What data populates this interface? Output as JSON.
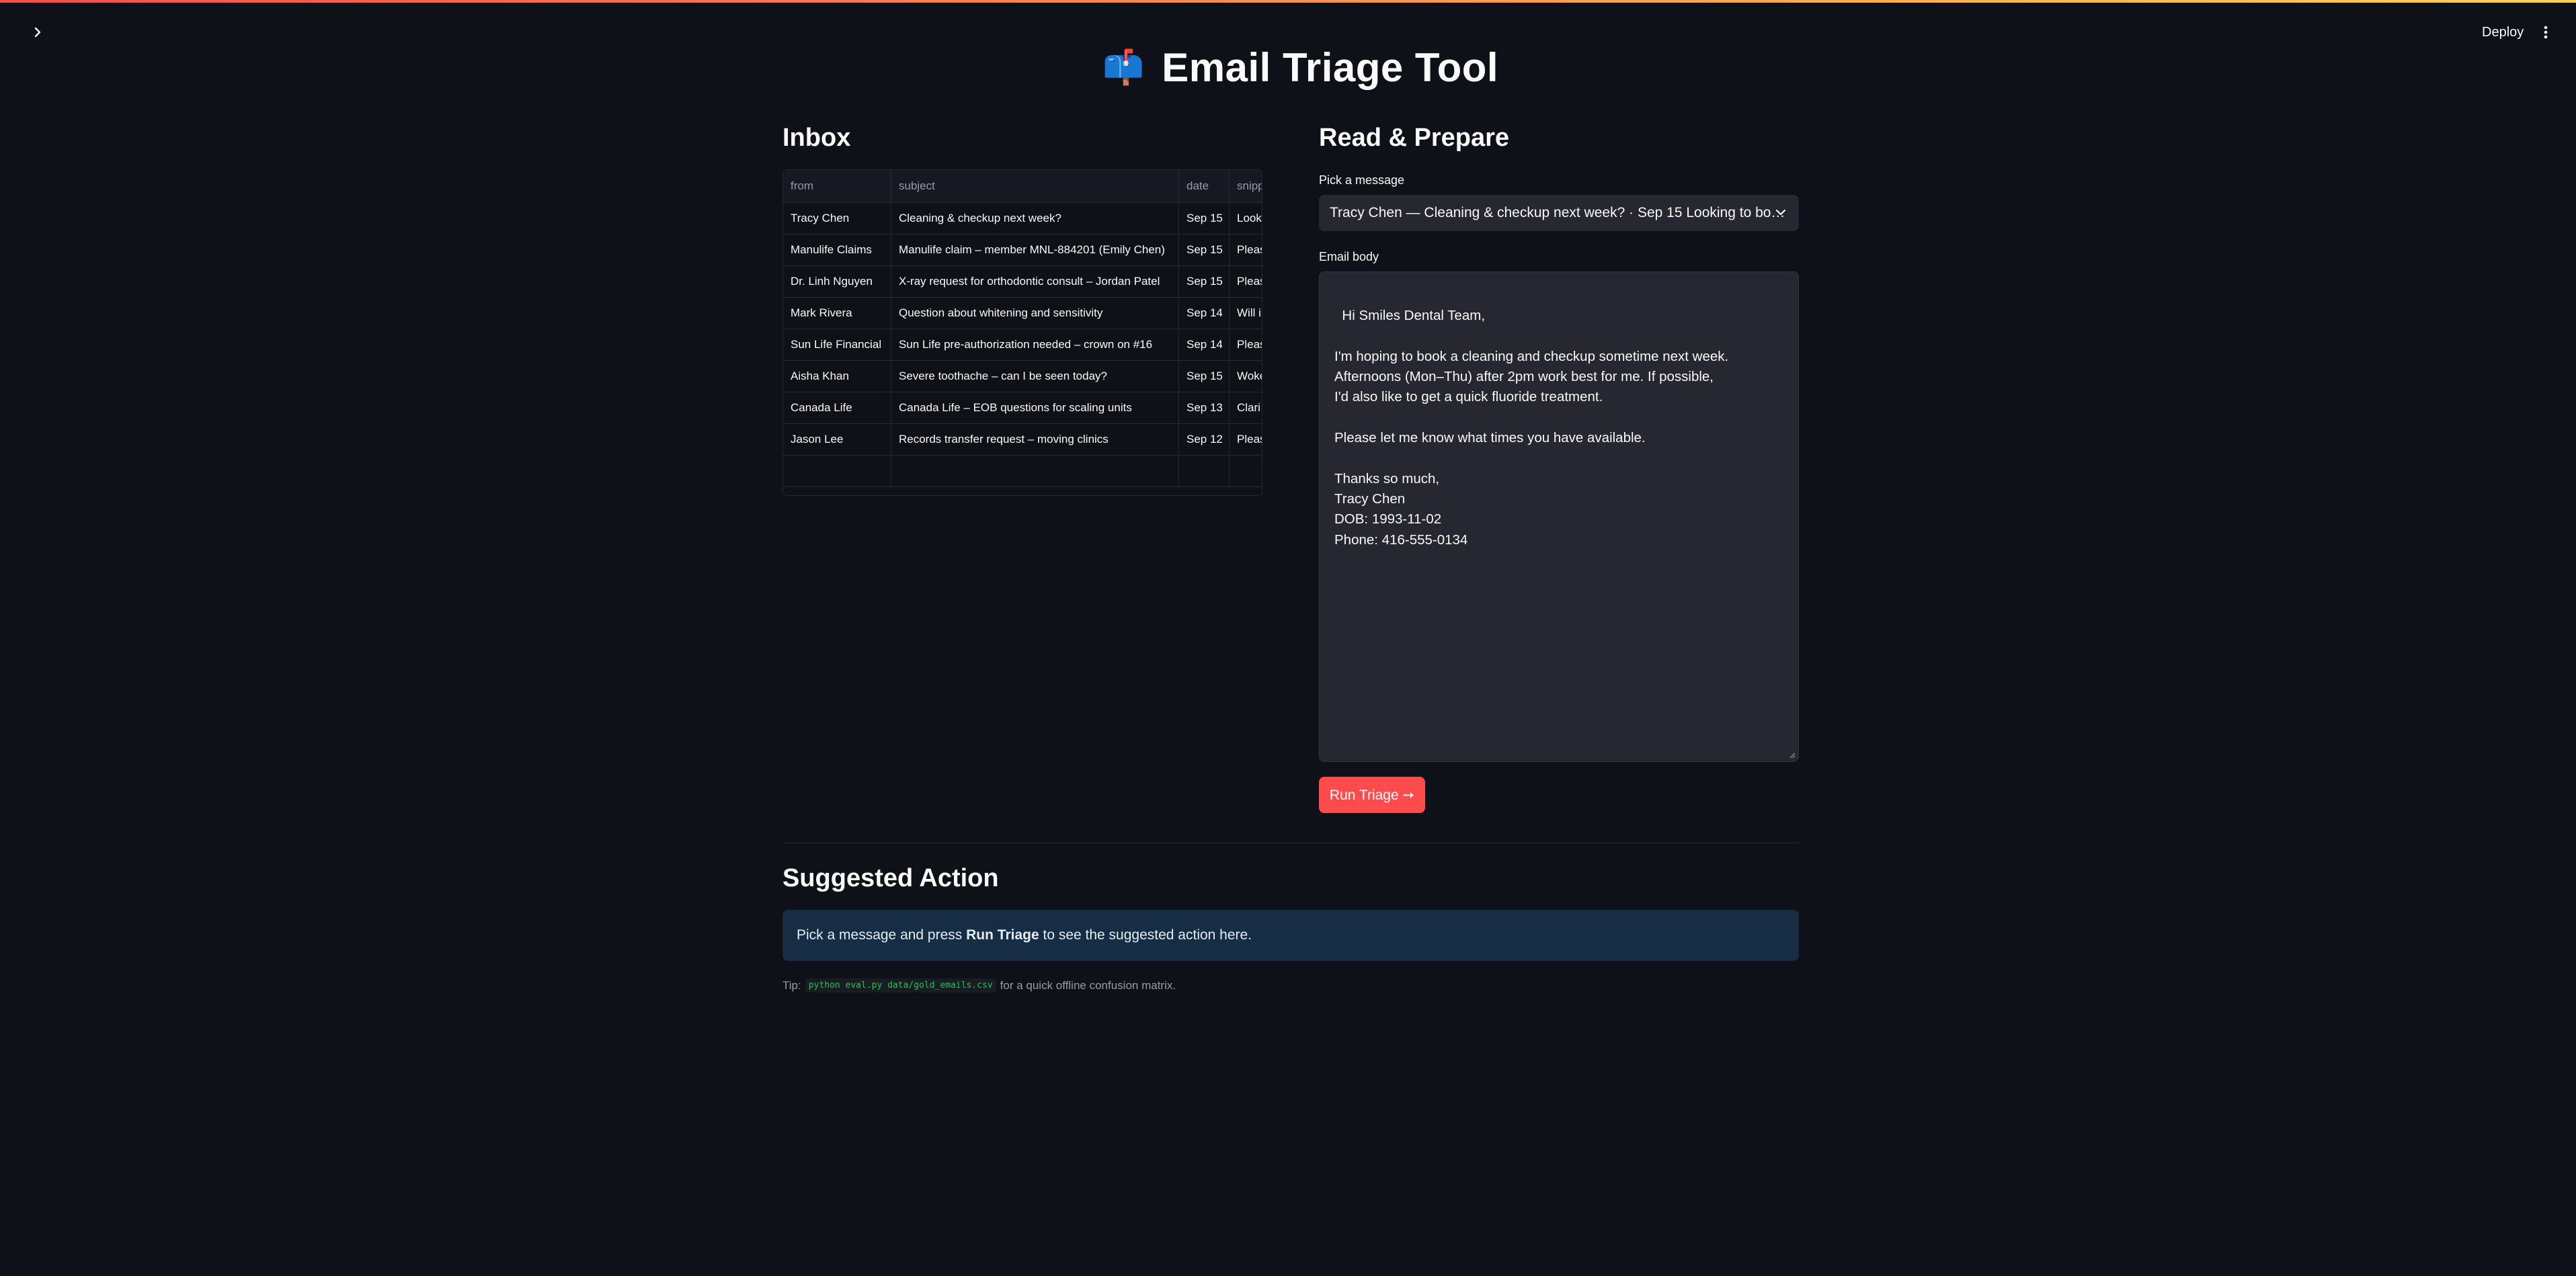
{
  "header": {
    "deploy_label": "Deploy"
  },
  "page": {
    "icon": "📫",
    "title": "Email Triage Tool"
  },
  "inbox": {
    "heading": "Inbox",
    "columns": [
      "from",
      "subject",
      "date",
      "snipp"
    ],
    "rows": [
      {
        "from": "Tracy Chen",
        "subject": "Cleaning & checkup next week?",
        "date": "Sep 15",
        "snippet": "Looki"
      },
      {
        "from": "Manulife Claims",
        "subject": "Manulife claim – member MNL-884201 (Emily Chen)",
        "date": "Sep 15",
        "snippet": "Pleas"
      },
      {
        "from": "Dr. Linh Nguyen",
        "subject": "X-ray request for orthodontic consult – Jordan Patel",
        "date": "Sep 15",
        "snippet": "Pleas"
      },
      {
        "from": "Mark Rivera",
        "subject": "Question about whitening and sensitivity",
        "date": "Sep 14",
        "snippet": "Will i"
      },
      {
        "from": "Sun Life Financial",
        "subject": "Sun Life pre-authorization needed – crown on #16",
        "date": "Sep 14",
        "snippet": "Pleas"
      },
      {
        "from": "Aisha Khan",
        "subject": "Severe toothache – can I be seen today?",
        "date": "Sep 15",
        "snippet": "Woke"
      },
      {
        "from": "Canada Life",
        "subject": "Canada Life – EOB questions for scaling units",
        "date": "Sep 13",
        "snippet": "Clari"
      },
      {
        "from": "Jason Lee",
        "subject": "Records transfer request – moving clinics",
        "date": "Sep 12",
        "snippet": "Pleas"
      }
    ]
  },
  "prepare": {
    "heading": "Read & Prepare",
    "pick_label": "Pick a message",
    "selected": "Tracy Chen — Cleaning & checkup next week? · Sep 15 Looking to bo…",
    "body_label": "Email body",
    "body": "Hi Smiles Dental Team,\n\nI'm hoping to book a cleaning and checkup sometime next week.\nAfternoons (Mon–Thu) after 2pm work best for me. If possible,\nI'd also like to get a quick fluoride treatment.\n\nPlease let me know what times you have available.\n\nThanks so much,\nTracy Chen\nDOB: 1993-11-02\nPhone: 416-555-0134",
    "run_label": "Run Triage ➙"
  },
  "suggested": {
    "heading": "Suggested Action",
    "info_prefix": "Pick a message and press ",
    "info_bold": "Run Triage",
    "info_suffix": " to see the suggested action here.",
    "tip_prefix": "Tip:",
    "tip_code": "python eval.py data/gold_emails.csv",
    "tip_suffix": "for a quick offline confusion matrix."
  },
  "colors": {
    "background": "#0e1117",
    "accent": "#ff4b4b",
    "info_bg": "#172d43",
    "code": "#21c354"
  }
}
